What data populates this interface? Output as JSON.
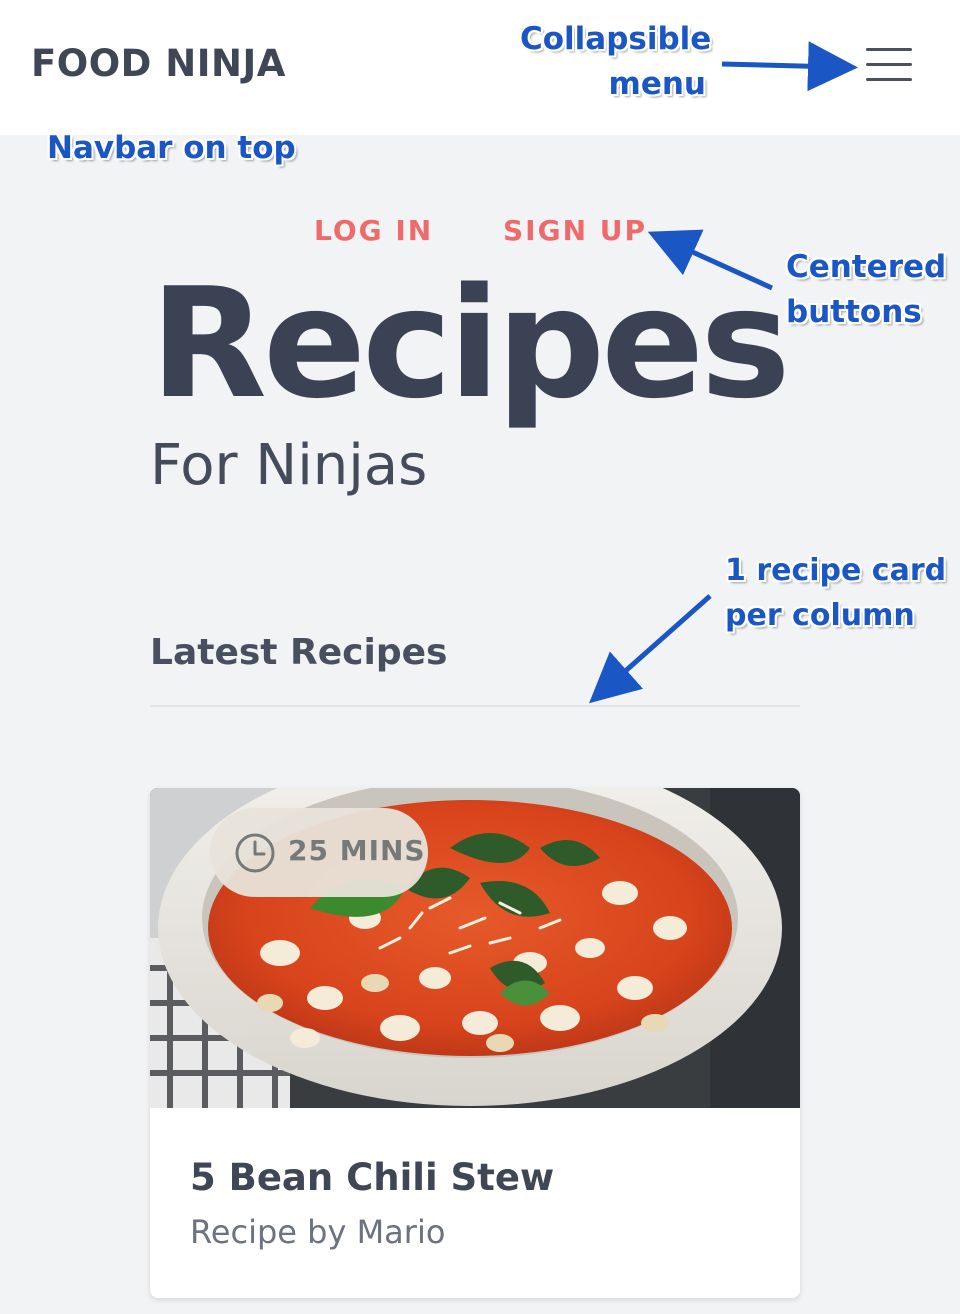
{
  "navbar": {
    "brand": "FOOD NINJA",
    "menu_icon": "hamburger-menu-icon"
  },
  "auth": {
    "login_label": "LOG IN",
    "signup_label": "SIGN UP"
  },
  "hero": {
    "title": "Recipes",
    "subtitle": "For Ninjas"
  },
  "latest": {
    "heading": "Latest Recipes",
    "cards": [
      {
        "time": "25 MINS",
        "time_icon": "clock-icon",
        "title": "5 Bean Chili Stew",
        "author": "Recipe by Mario"
      }
    ]
  },
  "annotations": {
    "collapsible_menu": [
      "Collapsible",
      "menu"
    ],
    "navbar_on_top": "Navbar on top",
    "centered_buttons": [
      "Centered",
      "buttons"
    ],
    "recipe_card": [
      "1 recipe card",
      "per column"
    ]
  },
  "colors": {
    "background": "#f2f3f5",
    "navbar": "#ffffff",
    "accent": "#ee6b6b",
    "text": "#3a4254",
    "annotation": "#1a56c4"
  }
}
